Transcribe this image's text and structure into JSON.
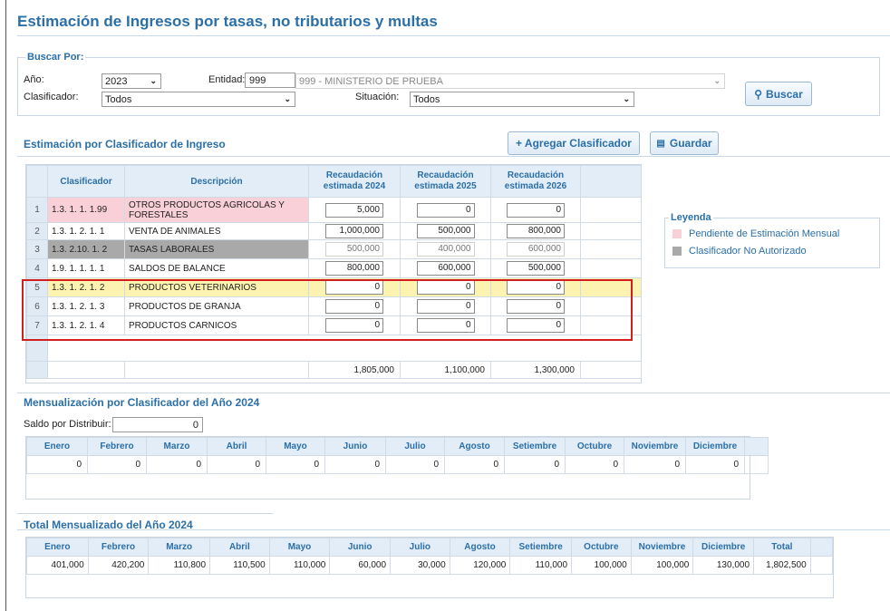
{
  "page": {
    "title": "Estimación de Ingresos por tasas, no tributarios y multas"
  },
  "search": {
    "legend": "Buscar Por:",
    "year_label": "Año:",
    "year_value": "2023",
    "entity_label": "Entidad:",
    "entity_code": "999",
    "entity_name": "999 - MINISTERIO DE PRUEBA",
    "classifier_label": "Clasificador:",
    "classifier_value": "Todos",
    "situation_label": "Situación:",
    "situation_value": "Todos",
    "search_button": "Buscar"
  },
  "estimation": {
    "title": "Estimación por Clasificador de Ingreso",
    "add_button": "+ Agregar Clasificador",
    "save_button": "Guardar",
    "headers": [
      "Clasificador",
      "Descripción",
      "Recaudación estimada 2024",
      "Recaudación estimada 2025",
      "Recaudación estimada 2026"
    ],
    "header_lines": {
      "h2024": [
        "Recaudación",
        "estimada 2024"
      ],
      "h2025": [
        "Recaudación",
        "estimada 2025"
      ],
      "h2026": [
        "Recaudación",
        "estimada 2026"
      ]
    },
    "rows": [
      {
        "n": "1",
        "code": "1.3. 1. 1. 1.99",
        "desc": "OTROS PRODUCTOS AGRICOLAS Y FORESTALES",
        "v2024": "5,000",
        "v2025": "0",
        "v2026": "0"
      },
      {
        "n": "2",
        "code": "1.3. 1. 2. 1. 1",
        "desc": "VENTA DE ANIMALES",
        "v2024": "1,000,000",
        "v2025": "500,000",
        "v2026": "800,000"
      },
      {
        "n": "3",
        "code": "1.3. 2.10. 1. 2",
        "desc": "TASAS LABORALES",
        "v2024": "500,000",
        "v2025": "400,000",
        "v2026": "600,000"
      },
      {
        "n": "4",
        "code": "1.9. 1. 1. 1. 1",
        "desc": "SALDOS DE BALANCE",
        "v2024": "800,000",
        "v2025": "600,000",
        "v2026": "500,000"
      },
      {
        "n": "5",
        "code": "1.3. 1. 2. 1. 2",
        "desc": "PRODUCTOS VETERINARIOS",
        "v2024": "0",
        "v2025": "0",
        "v2026": "0"
      },
      {
        "n": "6",
        "code": "1.3. 1. 2. 1. 3",
        "desc": "PRODUCTOS DE GRANJA",
        "v2024": "0",
        "v2025": "0",
        "v2026": "0"
      },
      {
        "n": "7",
        "code": "1.3. 1. 2. 1. 4",
        "desc": "PRODUCTOS CARNICOS",
        "v2024": "0",
        "v2025": "0",
        "v2026": "0"
      }
    ],
    "totals": {
      "t2024": "1,805,000",
      "t2025": "1,100,000",
      "t2026": "1,300,000"
    }
  },
  "legend": {
    "title": "Leyenda",
    "items": [
      {
        "label": "Pendiente de Estimación Mensual",
        "color": "#f9d0d8"
      },
      {
        "label": "Clasificador No Autorizado",
        "color": "#a9a9a9"
      }
    ]
  },
  "monthly": {
    "title": "Mensualización por Clasificador del Año 2024",
    "balance_label": "Saldo por Distribuir:",
    "balance_value": "0",
    "months": [
      "Enero",
      "Febrero",
      "Marzo",
      "Abril",
      "Mayo",
      "Junio",
      "Julio",
      "Agosto",
      "Setiembre",
      "Octubre",
      "Noviembre",
      "Diciembre"
    ],
    "values": [
      "0",
      "0",
      "0",
      "0",
      "0",
      "0",
      "0",
      "0",
      "0",
      "0",
      "0",
      "0"
    ]
  },
  "total_monthly": {
    "title": "Total Mensualizado del Año 2024",
    "headers": [
      "Enero",
      "Febrero",
      "Marzo",
      "Abril",
      "Mayo",
      "Junio",
      "Julio",
      "Agosto",
      "Setiembre",
      "Octubre",
      "Noviembre",
      "Diciembre",
      "Total"
    ],
    "values": [
      "401,000",
      "420,200",
      "110,800",
      "110,500",
      "110,000",
      "60,000",
      "30,000",
      "120,000",
      "110,000",
      "100,000",
      "100,000",
      "130,000",
      "1,802,500"
    ]
  },
  "colors": {
    "accent": "#2a6fa8",
    "pending_row": "#f9d0d8",
    "unauthorized_row": "#a9a9a9",
    "selected_row": "#fdf3b0",
    "highlight_border": "#d11f1f"
  }
}
